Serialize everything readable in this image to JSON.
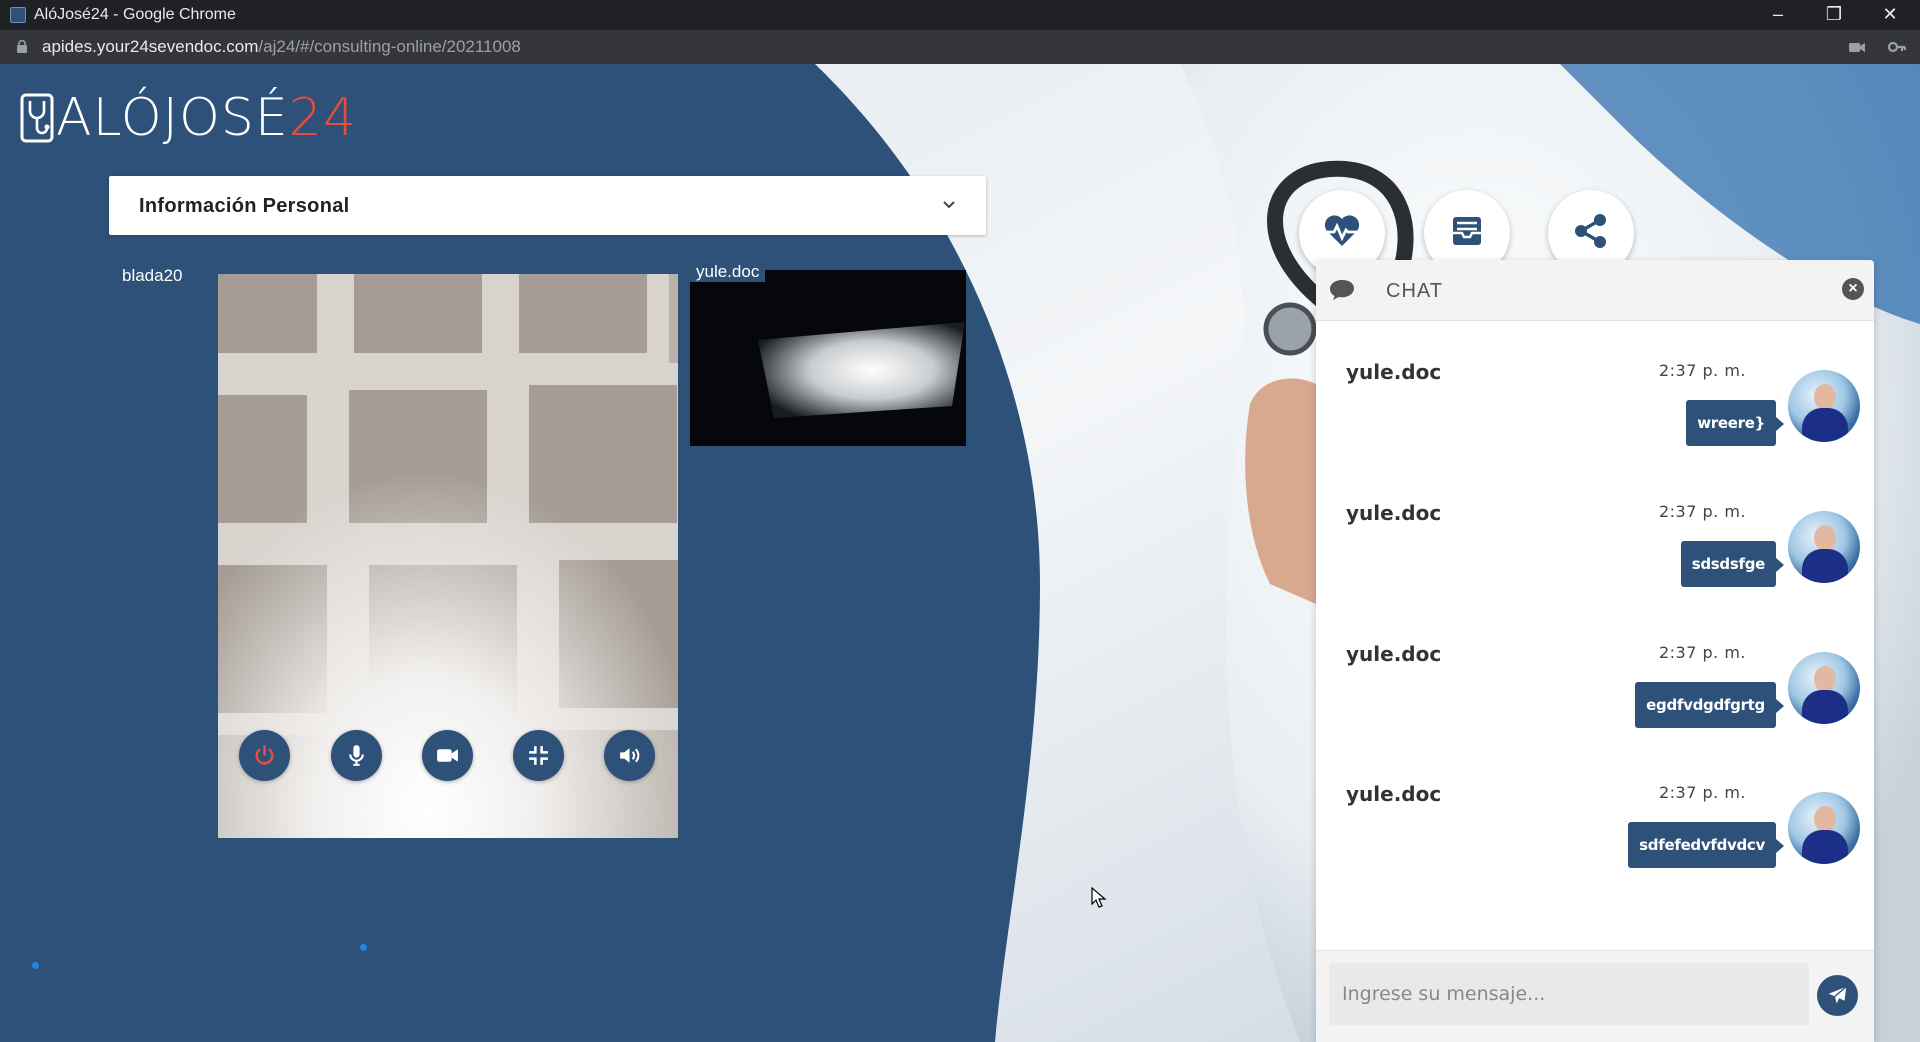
{
  "browser": {
    "window_title": "AlóJosé24 - Google Chrome",
    "url_host": "apides.your24sevendoc.com",
    "url_path": "/aj24/#/consulting-online/20211008",
    "window_buttons": [
      "minimize-icon",
      "restore-icon",
      "close-icon"
    ]
  },
  "logo": {
    "word": "ALÓJOSÉ",
    "number": "24"
  },
  "personal_info": {
    "label": "Información Personal",
    "icon": "chevron-down-icon"
  },
  "video": {
    "local_user": "blada20",
    "remote_user": "yule.doc",
    "controls": [
      "power-icon",
      "microphone-icon",
      "video-camera-icon",
      "compress-icon",
      "volume-icon"
    ]
  },
  "actions": [
    "heartbeat-icon",
    "inbox-icon",
    "share-icon"
  ],
  "chat": {
    "title": "CHAT",
    "messages": [
      {
        "sender": "yule.doc",
        "time": "2:37 p. m.",
        "text": "wreere}"
      },
      {
        "sender": "yule.doc",
        "time": "2:37 p. m.",
        "text": "sdsdsfge"
      },
      {
        "sender": "yule.doc",
        "time": "2:37 p. m.",
        "text": "egdfvdgdfgrtg"
      },
      {
        "sender": "yule.doc",
        "time": "2:37 p. m.",
        "text": "sdfefedvfdvdcv"
      }
    ],
    "input_placeholder": "Ingrese su mensaje...",
    "input_value": ""
  },
  "colors": {
    "primary": "#2e5179",
    "accent_red": "#e74c3c",
    "dot_blue": "#1e88e5"
  }
}
